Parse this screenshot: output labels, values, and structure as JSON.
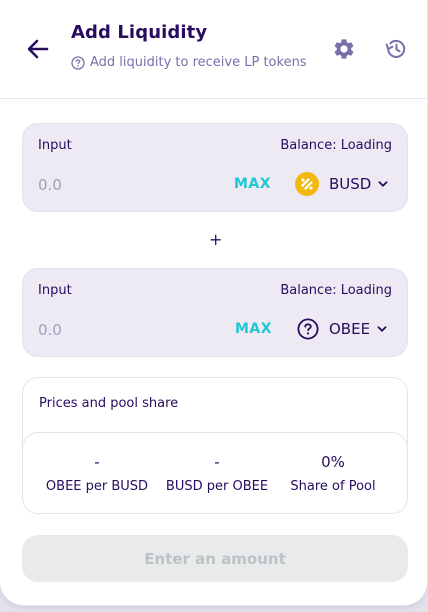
{
  "header": {
    "title": "Add Liquidity",
    "subtitle": "Add liquidity to receive LP tokens",
    "icons": {
      "back": "arrow-left-icon",
      "help": "question-circle-icon",
      "settings": "gear-icon",
      "history": "history-icon"
    }
  },
  "inputs": [
    {
      "label": "Input",
      "balance": "Balance: Loading",
      "amount": "0.0",
      "max_label": "MAX",
      "token": "BUSD",
      "token_icon": "busd-logo-icon"
    },
    {
      "label": "Input",
      "balance": "Balance: Loading",
      "amount": "0.0",
      "max_label": "MAX",
      "token": "OBEE",
      "token_icon": "unknown-token-question-icon"
    }
  ],
  "plus_sign": "+",
  "prices": {
    "title": "Prices and pool share",
    "stats": [
      {
        "value": "-",
        "caption": "OBEE per BUSD"
      },
      {
        "value": "-",
        "caption": "BUSD per OBEE"
      },
      {
        "value": "0%",
        "caption": "Share of Pool"
      }
    ]
  },
  "cta": {
    "label": "Enter an amount"
  },
  "colors": {
    "text_primary": "#280d5f",
    "text_secondary": "#7a6eaa",
    "accent_cyan": "#1fc7d4",
    "input_bg": "#eeeaf4",
    "busd_yellow": "#f0b90b",
    "disabled_bg": "#e9eaeb",
    "disabled_text": "#bdc2c4"
  }
}
